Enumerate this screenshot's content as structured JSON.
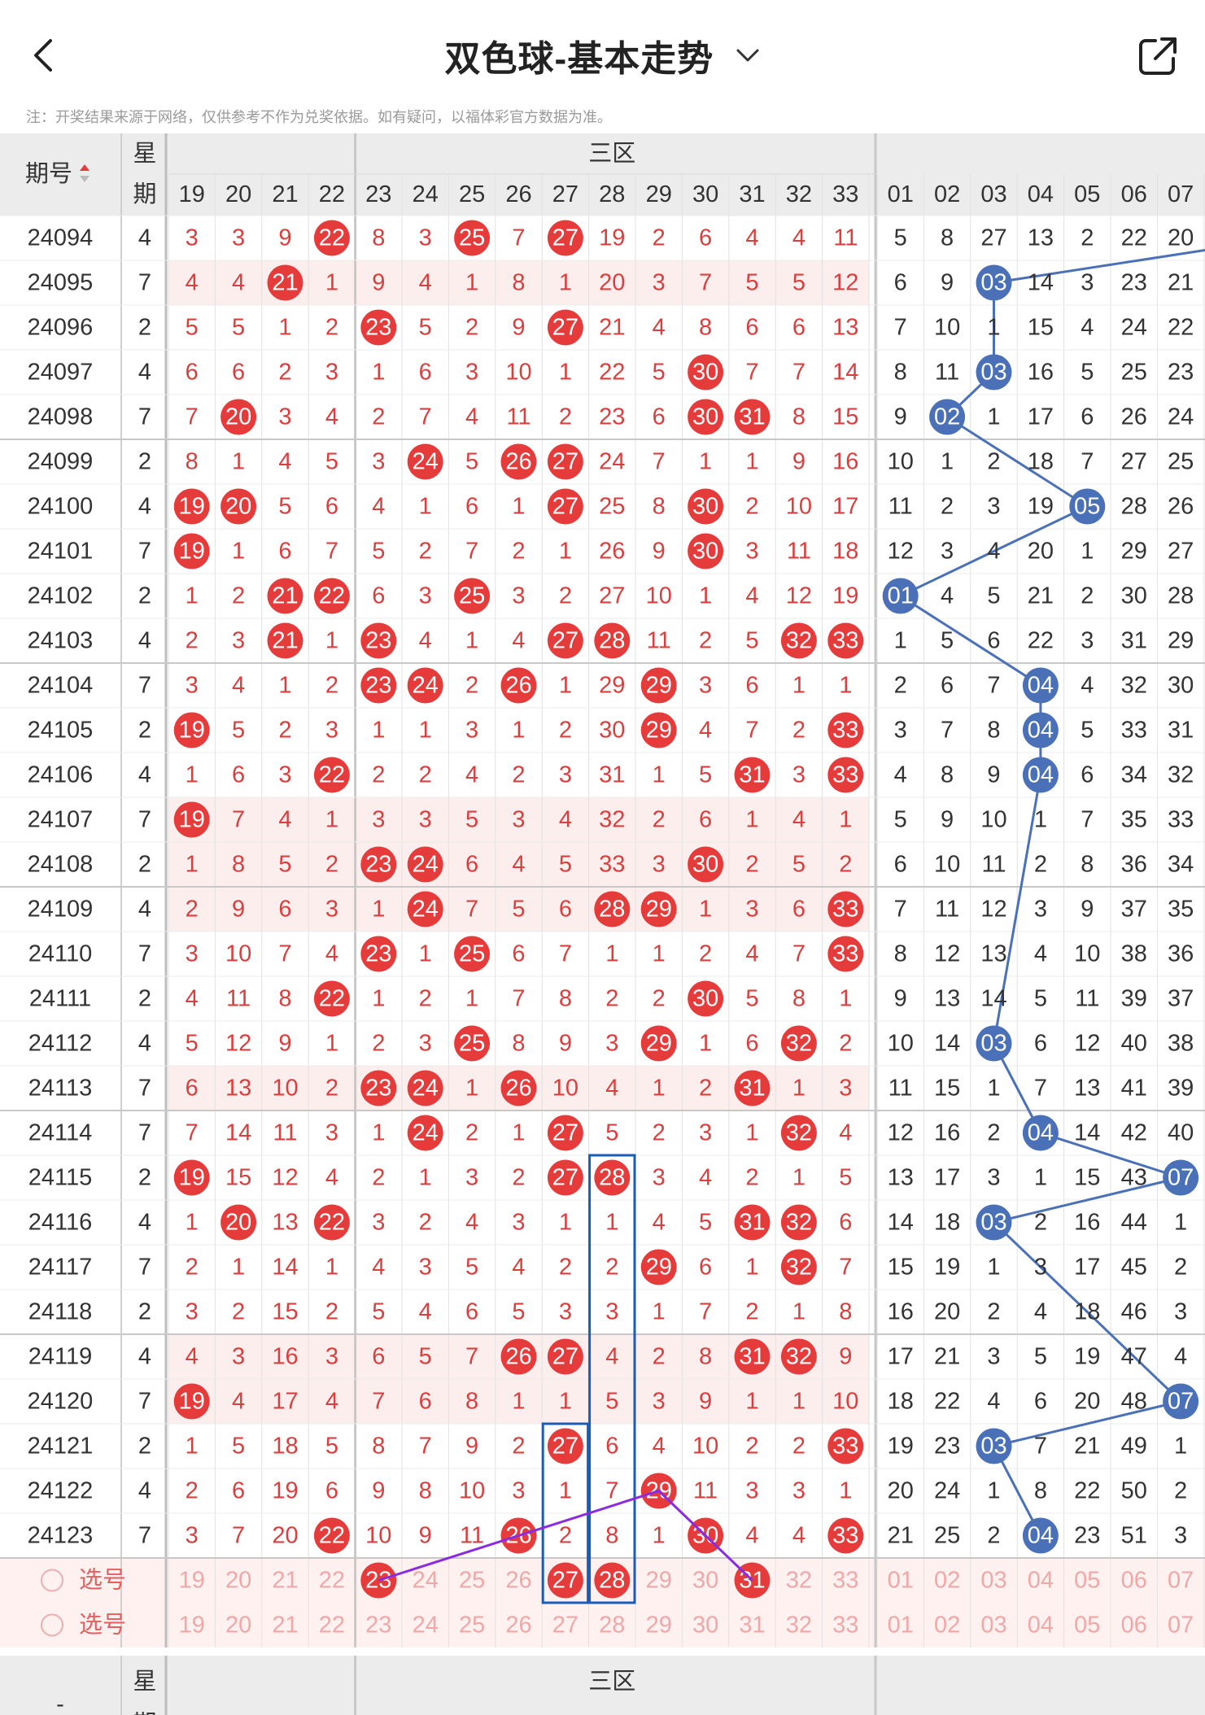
{
  "header": {
    "title": "双色球-基本走势",
    "notice": "注：开奖结果来源于网络，仅供参考不作为兑奖依据。如有疑问，以福体彩官方数据为准。"
  },
  "table": {
    "period_label": "期号",
    "week_label_1": "星",
    "week_label_2": "期",
    "zone_label": "三区",
    "red_cols": [
      "19",
      "20",
      "21",
      "22",
      "23",
      "24",
      "25",
      "26",
      "27",
      "28",
      "29",
      "30",
      "31",
      "32",
      "33"
    ],
    "blue_cols": [
      "01",
      "02",
      "03",
      "04",
      "05",
      "06",
      "07"
    ],
    "rows": [
      {
        "period": "24094",
        "week": "4",
        "red": [
          "3",
          "3",
          "9",
          "22",
          "8",
          "3",
          "25",
          "7",
          "27",
          "19",
          "2",
          "6",
          "4",
          "4",
          "11"
        ],
        "blue": [
          "5",
          "8",
          "27",
          "13",
          "2",
          "22",
          "20"
        ]
      },
      {
        "period": "24095",
        "week": "7",
        "red": [
          "4",
          "4",
          "21",
          "1",
          "9",
          "4",
          "1",
          "8",
          "1",
          "20",
          "3",
          "7",
          "5",
          "5",
          "12"
        ],
        "blue": [
          "6",
          "9",
          "03",
          "14",
          "3",
          "23",
          "21"
        ]
      },
      {
        "period": "24096",
        "week": "2",
        "red": [
          "5",
          "5",
          "1",
          "2",
          "23",
          "5",
          "2",
          "9",
          "27",
          "21",
          "4",
          "8",
          "6",
          "6",
          "13"
        ],
        "blue": [
          "7",
          "10",
          "1",
          "15",
          "4",
          "24",
          "22"
        ]
      },
      {
        "period": "24097",
        "week": "4",
        "red": [
          "6",
          "6",
          "2",
          "3",
          "1",
          "6",
          "3",
          "10",
          "1",
          "22",
          "5",
          "30",
          "7",
          "7",
          "14"
        ],
        "blue": [
          "8",
          "11",
          "03",
          "16",
          "5",
          "25",
          "23"
        ]
      },
      {
        "period": "24098",
        "week": "7",
        "red": [
          "7",
          "20",
          "3",
          "4",
          "2",
          "7",
          "4",
          "11",
          "2",
          "23",
          "6",
          "30",
          "31",
          "8",
          "15"
        ],
        "blue": [
          "9",
          "02",
          "1",
          "17",
          "6",
          "26",
          "24"
        ]
      },
      {
        "period": "24099",
        "week": "2",
        "red": [
          "8",
          "1",
          "4",
          "5",
          "3",
          "24",
          "5",
          "26",
          "27",
          "24",
          "7",
          "1",
          "1",
          "9",
          "16"
        ],
        "blue": [
          "10",
          "1",
          "2",
          "18",
          "7",
          "27",
          "25"
        ]
      },
      {
        "period": "24100",
        "week": "4",
        "red": [
          "19",
          "20",
          "5",
          "6",
          "4",
          "1",
          "6",
          "1",
          "27",
          "25",
          "8",
          "30",
          "2",
          "10",
          "17"
        ],
        "blue": [
          "11",
          "2",
          "3",
          "19",
          "05",
          "28",
          "26"
        ]
      },
      {
        "period": "24101",
        "week": "7",
        "red": [
          "19",
          "1",
          "6",
          "7",
          "5",
          "2",
          "7",
          "2",
          "1",
          "26",
          "9",
          "30",
          "3",
          "11",
          "18"
        ],
        "blue": [
          "12",
          "3",
          "4",
          "20",
          "1",
          "29",
          "27"
        ]
      },
      {
        "period": "24102",
        "week": "2",
        "red": [
          "1",
          "2",
          "21",
          "22",
          "6",
          "3",
          "25",
          "3",
          "2",
          "27",
          "10",
          "1",
          "4",
          "12",
          "19"
        ],
        "blue": [
          "01",
          "4",
          "5",
          "21",
          "2",
          "30",
          "28"
        ]
      },
      {
        "period": "24103",
        "week": "4",
        "red": [
          "2",
          "3",
          "21",
          "1",
          "23",
          "4",
          "1",
          "4",
          "27",
          "28",
          "11",
          "2",
          "5",
          "32",
          "33"
        ],
        "blue": [
          "1",
          "5",
          "6",
          "22",
          "3",
          "31",
          "29"
        ]
      },
      {
        "period": "24104",
        "week": "7",
        "red": [
          "3",
          "4",
          "1",
          "2",
          "23",
          "24",
          "2",
          "26",
          "1",
          "29",
          "29",
          "3",
          "6",
          "1",
          "1"
        ],
        "blue": [
          "2",
          "6",
          "7",
          "04",
          "4",
          "32",
          "30"
        ]
      },
      {
        "period": "24105",
        "week": "2",
        "red": [
          "19",
          "5",
          "2",
          "3",
          "1",
          "1",
          "3",
          "1",
          "2",
          "30",
          "29",
          "4",
          "7",
          "2",
          "33"
        ],
        "blue": [
          "3",
          "7",
          "8",
          "04",
          "5",
          "33",
          "31"
        ]
      },
      {
        "period": "24106",
        "week": "4",
        "red": [
          "1",
          "6",
          "3",
          "22",
          "2",
          "2",
          "4",
          "2",
          "3",
          "31",
          "1",
          "5",
          "31",
          "3",
          "33"
        ],
        "blue": [
          "4",
          "8",
          "9",
          "04",
          "6",
          "34",
          "32"
        ]
      },
      {
        "period": "24107",
        "week": "7",
        "red": [
          "19",
          "7",
          "4",
          "1",
          "3",
          "3",
          "5",
          "3",
          "4",
          "32",
          "2",
          "6",
          "1",
          "4",
          "1"
        ],
        "blue": [
          "5",
          "9",
          "10",
          "1",
          "7",
          "35",
          "33"
        ]
      },
      {
        "period": "24108",
        "week": "2",
        "red": [
          "1",
          "8",
          "5",
          "2",
          "23",
          "24",
          "6",
          "4",
          "5",
          "33",
          "3",
          "30",
          "2",
          "5",
          "2"
        ],
        "blue": [
          "6",
          "10",
          "11",
          "2",
          "8",
          "36",
          "34"
        ]
      },
      {
        "period": "24109",
        "week": "4",
        "red": [
          "2",
          "9",
          "6",
          "3",
          "1",
          "24",
          "7",
          "5",
          "6",
          "28",
          "29",
          "1",
          "3",
          "6",
          "33"
        ],
        "blue": [
          "7",
          "11",
          "12",
          "3",
          "9",
          "37",
          "35"
        ]
      },
      {
        "period": "24110",
        "week": "7",
        "red": [
          "3",
          "10",
          "7",
          "4",
          "23",
          "1",
          "25",
          "6",
          "7",
          "1",
          "1",
          "2",
          "4",
          "7",
          "33"
        ],
        "blue": [
          "8",
          "12",
          "13",
          "4",
          "10",
          "38",
          "36"
        ]
      },
      {
        "period": "24111",
        "week": "2",
        "red": [
          "4",
          "11",
          "8",
          "22",
          "1",
          "2",
          "1",
          "7",
          "8",
          "2",
          "2",
          "30",
          "5",
          "8",
          "1"
        ],
        "blue": [
          "9",
          "13",
          "14",
          "5",
          "11",
          "39",
          "37"
        ]
      },
      {
        "period": "24112",
        "week": "4",
        "red": [
          "5",
          "12",
          "9",
          "1",
          "2",
          "3",
          "25",
          "8",
          "9",
          "3",
          "29",
          "1",
          "6",
          "32",
          "2"
        ],
        "blue": [
          "10",
          "14",
          "03",
          "6",
          "12",
          "40",
          "38"
        ]
      },
      {
        "period": "24113",
        "week": "7",
        "red": [
          "6",
          "13",
          "10",
          "2",
          "23",
          "24",
          "1",
          "26",
          "10",
          "4",
          "1",
          "2",
          "31",
          "1",
          "3"
        ],
        "blue": [
          "11",
          "15",
          "1",
          "7",
          "13",
          "41",
          "39"
        ]
      },
      {
        "period": "24114",
        "week": "7",
        "red": [
          "7",
          "14",
          "11",
          "3",
          "1",
          "24",
          "2",
          "1",
          "27",
          "5",
          "2",
          "3",
          "1",
          "32",
          "4"
        ],
        "blue": [
          "12",
          "16",
          "2",
          "04",
          "14",
          "42",
          "40"
        ]
      },
      {
        "period": "24115",
        "week": "2",
        "red": [
          "19",
          "15",
          "12",
          "4",
          "2",
          "1",
          "3",
          "2",
          "27",
          "28",
          "3",
          "4",
          "2",
          "1",
          "5"
        ],
        "blue": [
          "13",
          "17",
          "3",
          "1",
          "15",
          "43",
          "07"
        ]
      },
      {
        "period": "24116",
        "week": "4",
        "red": [
          "1",
          "20",
          "13",
          "22",
          "3",
          "2",
          "4",
          "3",
          "1",
          "1",
          "4",
          "5",
          "31",
          "32",
          "6"
        ],
        "blue": [
          "14",
          "18",
          "03",
          "2",
          "16",
          "44",
          "1"
        ]
      },
      {
        "period": "24117",
        "week": "7",
        "red": [
          "2",
          "1",
          "14",
          "1",
          "4",
          "3",
          "5",
          "4",
          "2",
          "2",
          "29",
          "6",
          "1",
          "32",
          "7"
        ],
        "blue": [
          "15",
          "19",
          "1",
          "3",
          "17",
          "45",
          "2"
        ]
      },
      {
        "period": "24118",
        "week": "2",
        "red": [
          "3",
          "2",
          "15",
          "2",
          "5",
          "4",
          "6",
          "5",
          "3",
          "3",
          "1",
          "7",
          "2",
          "1",
          "8"
        ],
        "blue": [
          "16",
          "20",
          "2",
          "4",
          "18",
          "46",
          "3"
        ]
      },
      {
        "period": "24119",
        "week": "4",
        "red": [
          "4",
          "3",
          "16",
          "3",
          "6",
          "5",
          "7",
          "26",
          "27",
          "4",
          "2",
          "8",
          "31",
          "32",
          "9"
        ],
        "blue": [
          "17",
          "21",
          "3",
          "5",
          "19",
          "47",
          "4"
        ]
      },
      {
        "period": "24120",
        "week": "7",
        "red": [
          "19",
          "4",
          "17",
          "4",
          "7",
          "6",
          "8",
          "1",
          "1",
          "5",
          "3",
          "9",
          "1",
          "1",
          "10"
        ],
        "blue": [
          "18",
          "22",
          "4",
          "6",
          "20",
          "48",
          "07"
        ]
      },
      {
        "period": "24121",
        "week": "2",
        "red": [
          "1",
          "5",
          "18",
          "5",
          "8",
          "7",
          "9",
          "2",
          "27",
          "6",
          "4",
          "10",
          "2",
          "2",
          "33"
        ],
        "blue": [
          "19",
          "23",
          "03",
          "7",
          "21",
          "49",
          "1"
        ]
      },
      {
        "period": "24122",
        "week": "4",
        "red": [
          "2",
          "6",
          "19",
          "6",
          "9",
          "8",
          "10",
          "3",
          "1",
          "7",
          "29",
          "11",
          "3",
          "3",
          "1"
        ],
        "blue": [
          "20",
          "24",
          "1",
          "8",
          "22",
          "50",
          "2"
        ]
      },
      {
        "period": "24123",
        "week": "7",
        "red": [
          "3",
          "7",
          "20",
          "22",
          "10",
          "9",
          "11",
          "26",
          "2",
          "8",
          "1",
          "30",
          "4",
          "4",
          "33"
        ],
        "blue": [
          "21",
          "25",
          "2",
          "04",
          "23",
          "51",
          "3"
        ]
      }
    ],
    "select_rows": [
      {
        "label": "选号",
        "selected": [
          "23",
          "27",
          "28",
          "31"
        ]
      },
      {
        "label": "选号",
        "selected": []
      }
    ],
    "footer": {
      "period": "-",
      "week_1": "星",
      "week_2": "期",
      "zone": "三区"
    }
  },
  "colors": {
    "red": "#e63b3b",
    "blue": "#4a70b8",
    "purple": "#8a2be2",
    "box": "#1a5cb8"
  }
}
